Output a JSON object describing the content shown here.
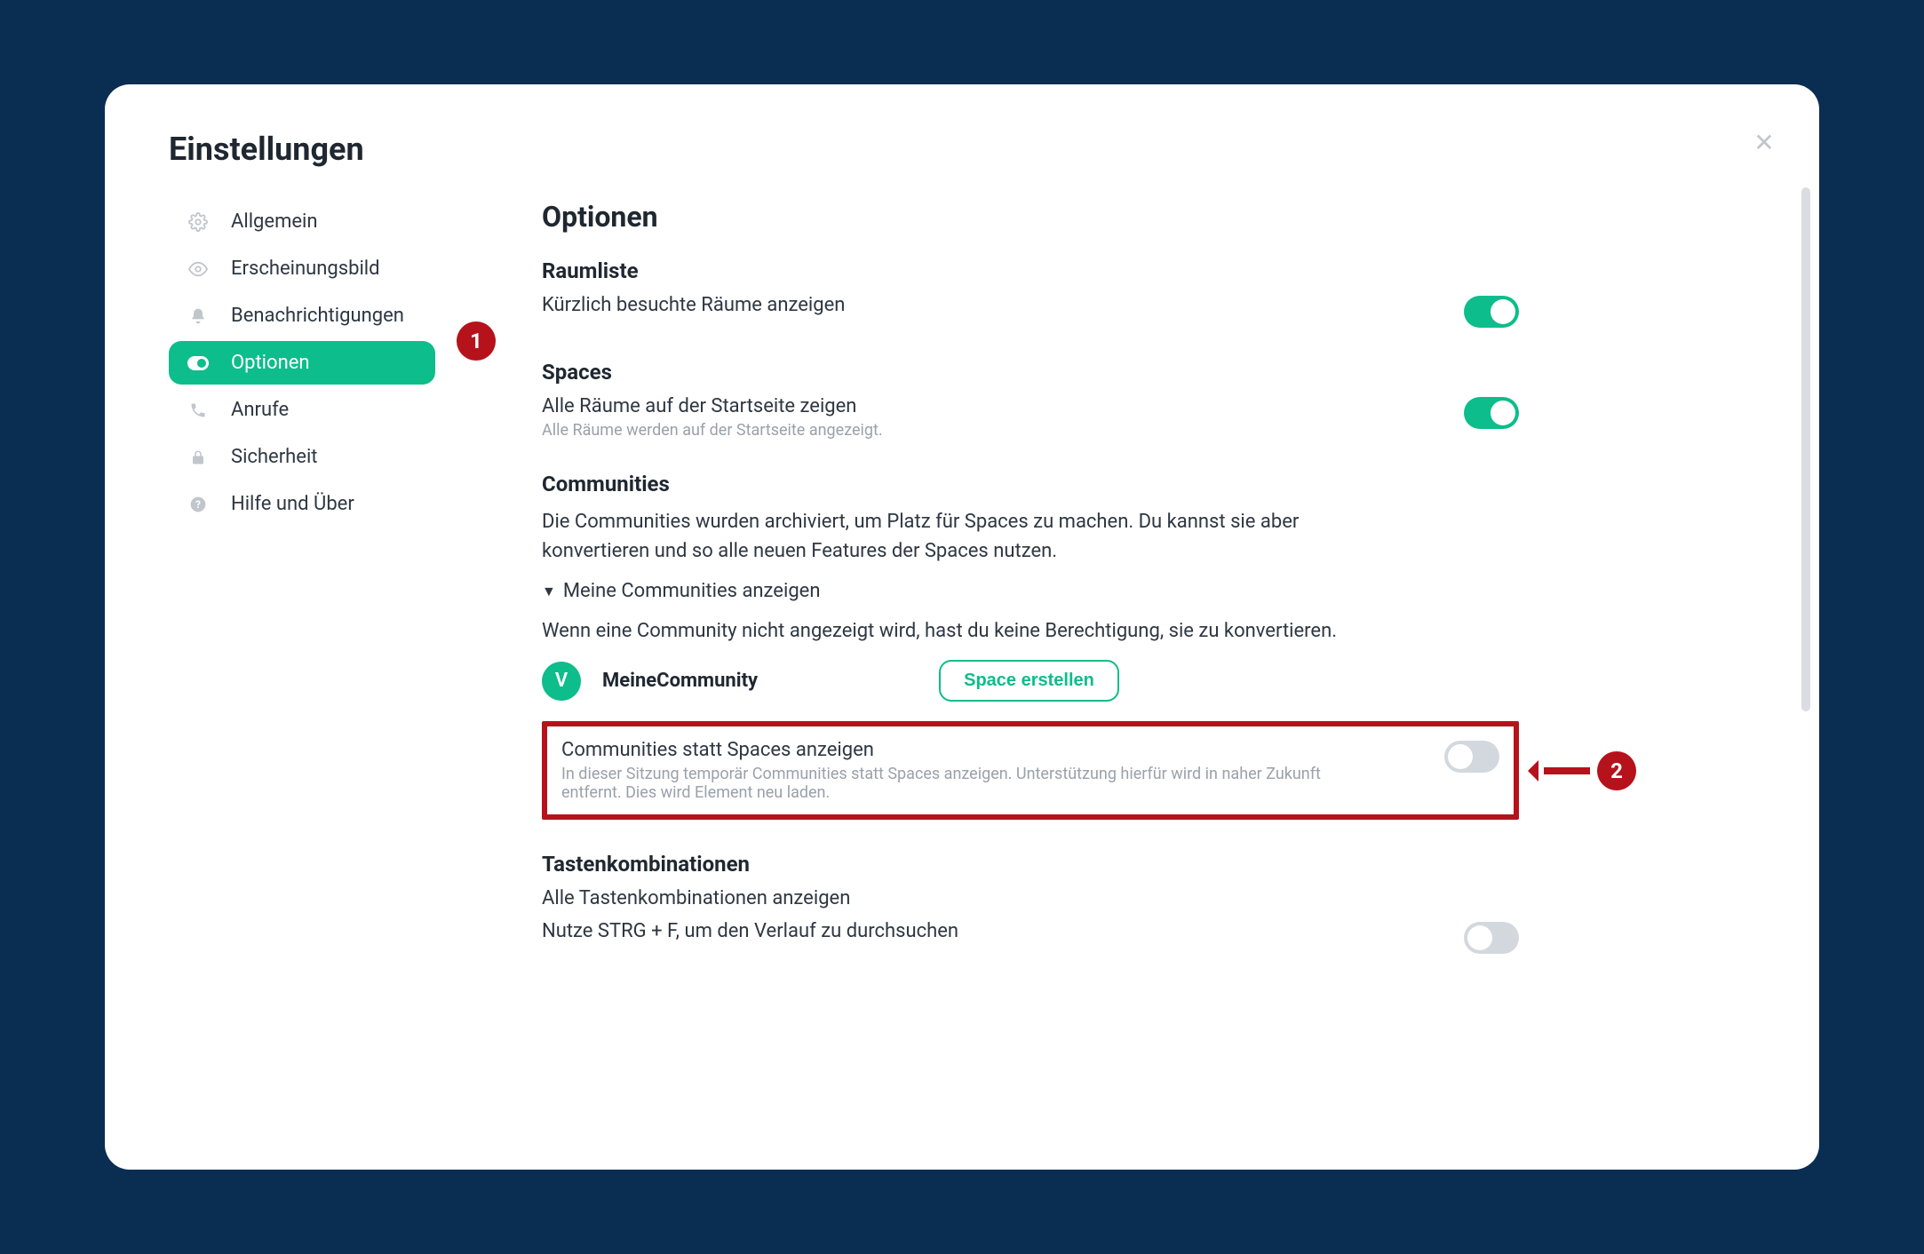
{
  "dialog": {
    "title": "Einstellungen"
  },
  "sidebar": {
    "items": [
      {
        "label": "Allgemein"
      },
      {
        "label": "Erscheinungsbild"
      },
      {
        "label": "Benachrichtigungen"
      },
      {
        "label": "Optionen"
      },
      {
        "label": "Anrufe"
      },
      {
        "label": "Sicherheit"
      },
      {
        "label": "Hilfe und Über"
      }
    ]
  },
  "main": {
    "heading": "Optionen",
    "roomlist": {
      "heading": "Raumliste",
      "recent_rooms_label": "Kürzlich besuchte Räume anzeigen"
    },
    "spaces": {
      "heading": "Spaces",
      "allrooms_label": "Alle Räume auf der Startseite zeigen",
      "allrooms_sub": "Alle Räume werden auf der Startseite angezeigt."
    },
    "communities": {
      "heading": "Communities",
      "archived_text": "Die Communities wurden archiviert, um Platz für Spaces zu machen. Du kannst sie aber konvertieren und so alle neuen Features der Spaces nutzen.",
      "disclosure_label": "Meine Communities anzeigen",
      "permission_text": "Wenn eine Community nicht angezeigt wird, hast du keine Berechtigung, sie zu konvertieren.",
      "items": [
        {
          "avatar_letter": "V",
          "name": "MeineCommunity"
        }
      ],
      "create_space_button": "Space erstellen",
      "show_communities_label": "Communities statt Spaces anzeigen",
      "show_communities_sub": "In dieser Sitzung temporär Communities statt Spaces anzeigen. Unterstützung hierfür wird in naher Zukunft entfernt. Dies wird Element neu laden."
    },
    "shortcuts": {
      "heading": "Tastenkombinationen",
      "show_all_label": "Alle Tastenkombinationen anzeigen",
      "ctrlf_label": "Nutze STRG + F, um den Verlauf zu durchsuchen"
    }
  },
  "annotations": {
    "badge1": "1",
    "badge2": "2"
  }
}
